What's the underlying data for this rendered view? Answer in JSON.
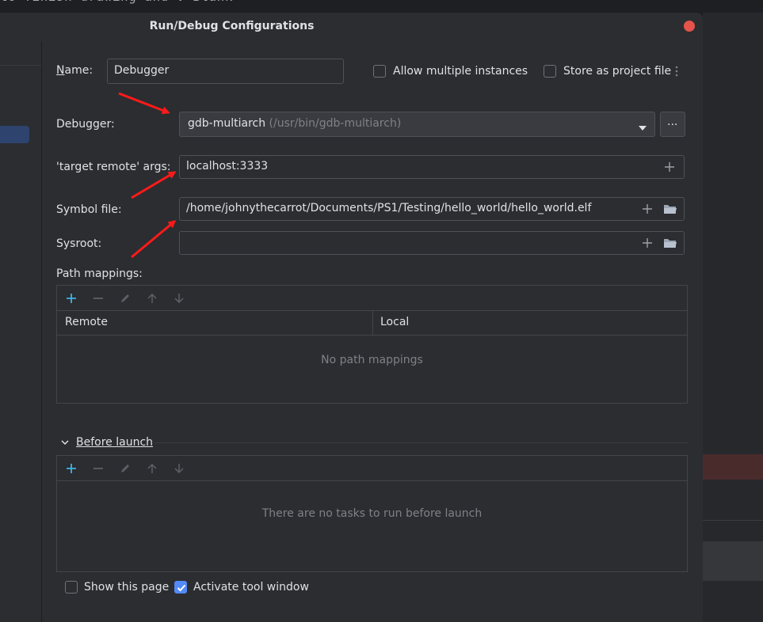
{
  "background": {
    "code_line": "to finish drawing and V-Blank"
  },
  "dialog": {
    "title": "Run/Debug Configurations",
    "name_label": "Name:",
    "name_value": "Debugger",
    "allow_multiple": {
      "label": "Allow multiple instances",
      "checked": false
    },
    "store_project": {
      "label": "Store as project file",
      "checked": false
    },
    "debugger_label": "Debugger:",
    "debugger_value": "gdb-multiarch",
    "debugger_path": "(/usr/bin/gdb-multiarch)",
    "debugger_more": "...",
    "target_remote_label": "'target remote' args:",
    "target_remote_value": "localhost:3333",
    "symbol_file_label": "Symbol file:",
    "symbol_file_value": "/home/johnythecarrot/Documents/PS1/Testing/hello_world/hello_world.elf",
    "sysroot_label": "Sysroot:",
    "sysroot_value": "",
    "path_mappings": {
      "label": "Path mappings:",
      "columns": [
        "Remote",
        "Local"
      ],
      "empty_text": "No path mappings"
    },
    "before_launch": {
      "label": "Before launch",
      "empty_text": "There are no tasks to run before launch"
    },
    "show_page": {
      "label": "Show this page",
      "checked": false
    },
    "activate_tool": {
      "label": "Activate tool window",
      "checked": true
    }
  },
  "colors": {
    "dialog_bg": "#2b2d30",
    "accent": "#548af7",
    "annotation_arrow": "#ff1a1a",
    "close_button": "#e5534b"
  }
}
